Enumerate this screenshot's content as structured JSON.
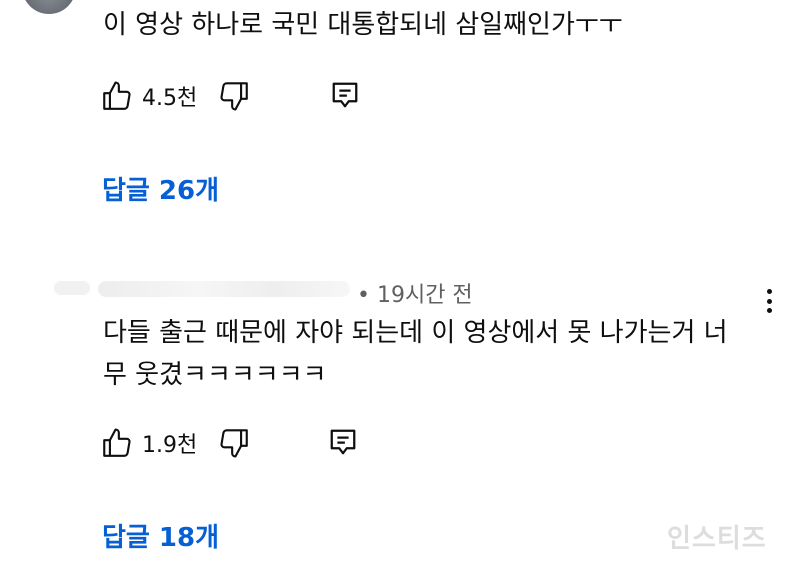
{
  "comments": [
    {
      "text_lines": [
        "이 영상 하나로 국민 대통합되네 삼일째인가ㅜㅜ"
      ],
      "likes": "4.5천",
      "replies_label": "답글 26개"
    },
    {
      "meta": "• 19시간 전",
      "text_lines": [
        "다들 출근 때문에 자야 되는데 이 영상에서 못 나가는거 너",
        "무 웃겼ㅋㅋㅋㅋㅋㅋ"
      ],
      "likes": "1.9천",
      "replies_label": "답글 18개"
    }
  ],
  "watermark": "인스티즈",
  "colors": {
    "link": "#065fd4",
    "text": "#0f0f0f",
    "meta": "#606060"
  },
  "icons": [
    "thumbs-up-icon",
    "thumbs-down-icon",
    "reply-icon",
    "more-vert-icon"
  ]
}
